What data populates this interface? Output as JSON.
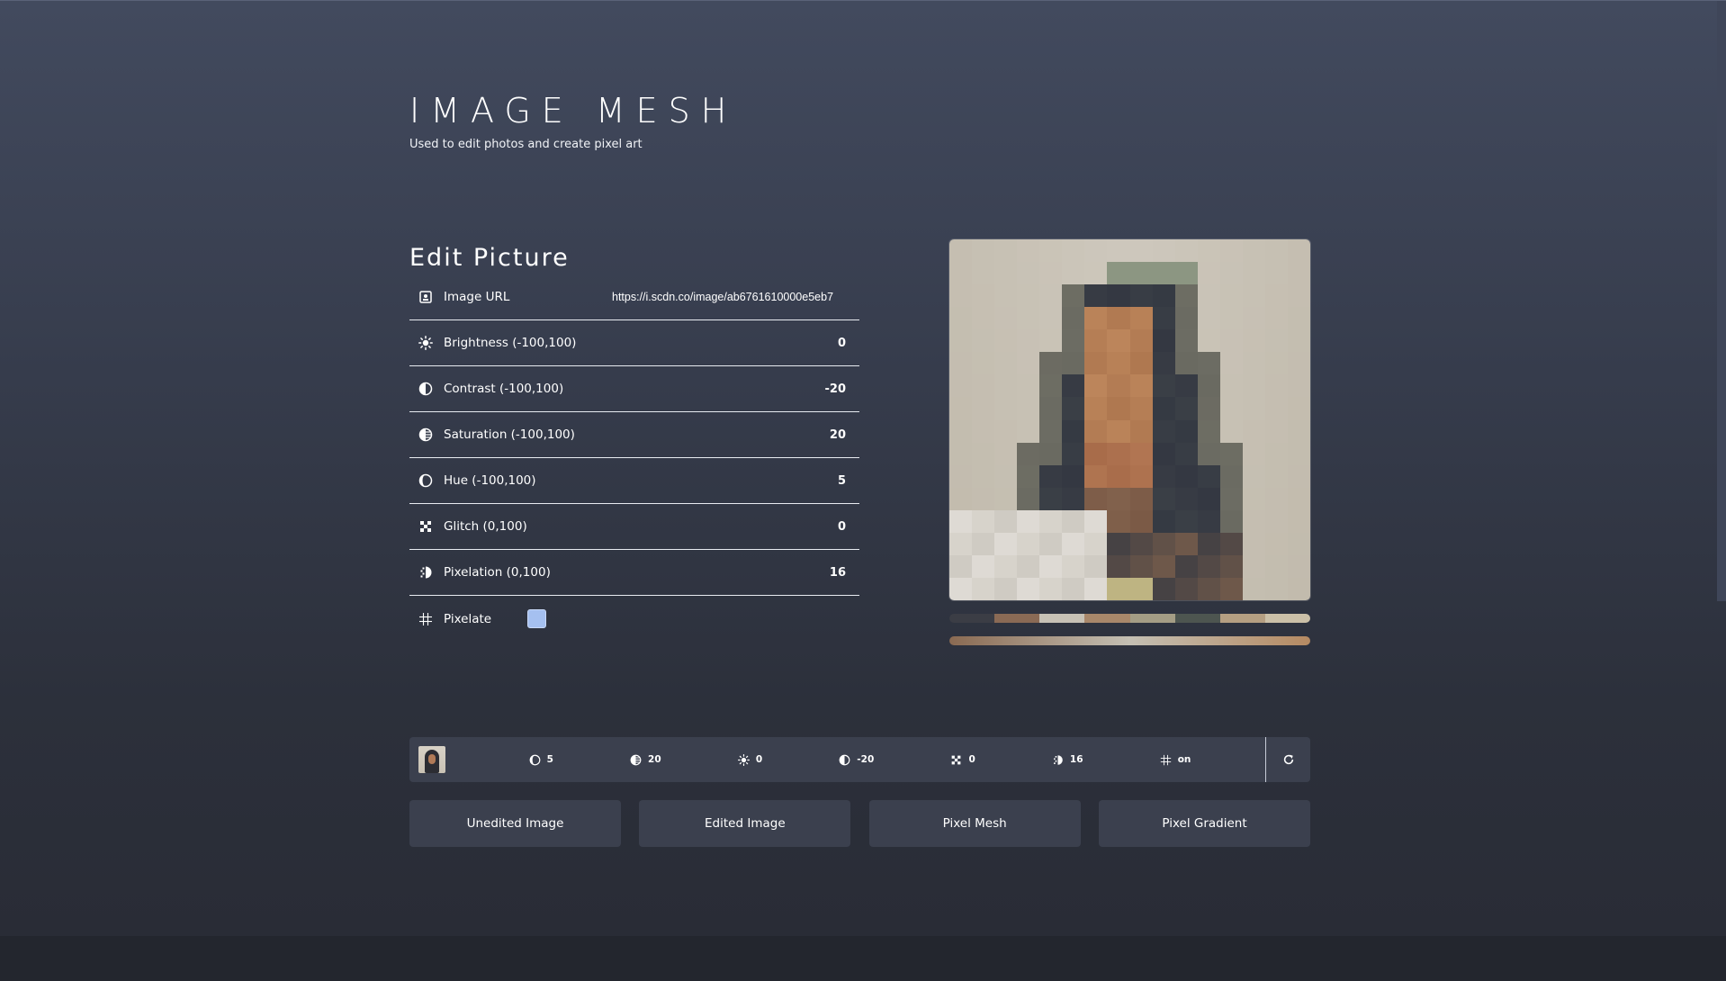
{
  "header": {
    "title": "IMAGE MESH",
    "subtitle": "Used to edit photos and create pixel art"
  },
  "edit_panel": {
    "title": "Edit Picture",
    "image_url": {
      "label": "Image URL",
      "value": "https://i.scdn.co/image/ab6761610000e5eb7",
      "icon": "image-icon"
    },
    "controls": [
      {
        "label": "Brightness (-100,100)",
        "value": "0",
        "icon": "sun-icon"
      },
      {
        "label": "Contrast (-100,100)",
        "value": "-20",
        "icon": "contrast-icon"
      },
      {
        "label": "Saturation (-100,100)",
        "value": "20",
        "icon": "saturation-icon"
      },
      {
        "label": "Hue (-100,100)",
        "value": "5",
        "icon": "hue-icon"
      },
      {
        "label": "Glitch (0,100)",
        "value": "0",
        "icon": "glitch-icon"
      },
      {
        "label": "Pixelation (0,100)",
        "value": "16",
        "icon": "pixelation-icon"
      }
    ],
    "pixelate": {
      "label": "Pixelate",
      "checked": true,
      "icon": "grid-icon"
    }
  },
  "preview": {
    "palette": [
      "#3b3d45",
      "#8a6a55",
      "#c7c1b5",
      "#a8876a",
      "#a49d85",
      "#4d5550",
      "#b59f82",
      "#cbc0a8"
    ],
    "gradient": [
      "#8a6a52",
      "#c4bfb3",
      "#b58a62"
    ]
  },
  "summary": {
    "items": [
      {
        "icon": "hue-icon",
        "value": "5"
      },
      {
        "icon": "saturation-icon",
        "value": "20"
      },
      {
        "icon": "sun-icon",
        "value": "0"
      },
      {
        "icon": "contrast-icon",
        "value": "-20"
      },
      {
        "icon": "glitch-icon",
        "value": "0"
      },
      {
        "icon": "pixelation-icon",
        "value": "16"
      },
      {
        "icon": "grid-icon",
        "value": "on"
      }
    ],
    "reset_icon": "refresh-icon"
  },
  "actions": [
    {
      "label": "Unedited Image"
    },
    {
      "label": "Edited Image"
    },
    {
      "label": "Pixel Mesh"
    },
    {
      "label": "Pixel Gradient"
    }
  ],
  "colors": {
    "background_top": "#424a5e",
    "background_bottom": "#292c36",
    "panel": "#3b404e",
    "checkbox": "#a5c0f0"
  }
}
